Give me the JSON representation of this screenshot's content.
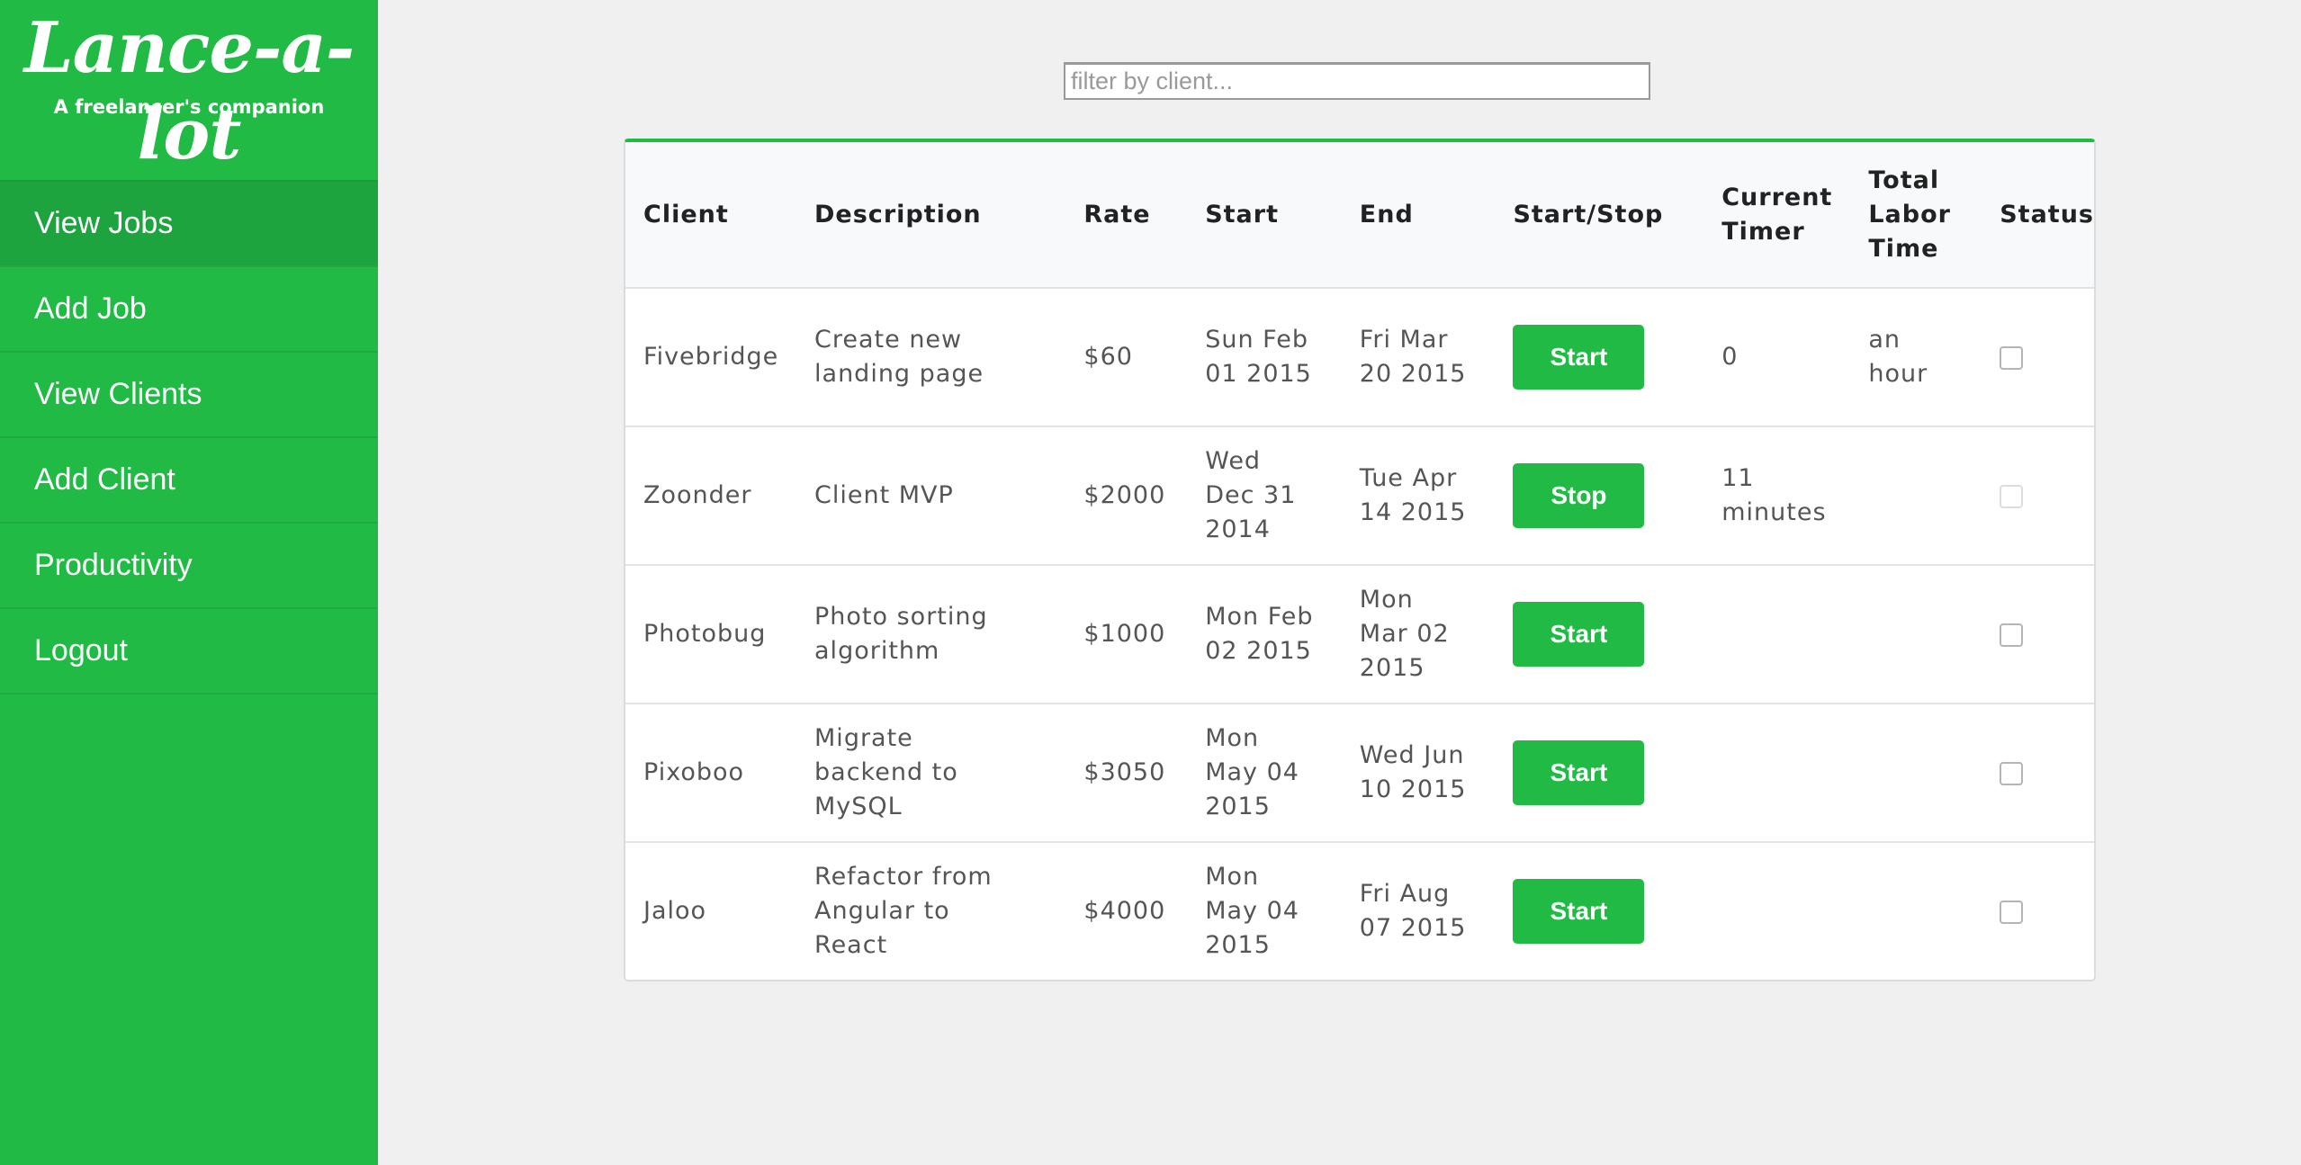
{
  "app": {
    "title": "Lance-a-lot",
    "subtitle": "A freelancer's companion"
  },
  "nav": {
    "items": [
      {
        "label": "View Jobs",
        "active": true
      },
      {
        "label": "Add Job"
      },
      {
        "label": "View Clients"
      },
      {
        "label": "Add Client"
      },
      {
        "label": "Productivity"
      },
      {
        "label": "Logout"
      }
    ]
  },
  "filter": {
    "placeholder": "filter by client...",
    "value": ""
  },
  "table": {
    "headers": [
      "Client",
      "Description",
      "Rate",
      "Start",
      "End",
      "Start/Stop",
      "Current Timer",
      "Total Labor Time",
      "Status"
    ],
    "rows": [
      {
        "client": "Fivebridge",
        "description": "Create new landing page",
        "rate": "$60",
        "start": "Sun Feb 01 2015",
        "end": "Fri Mar 20 2015",
        "action": "Start",
        "timer": "0",
        "labor": "an hour",
        "status": false
      },
      {
        "client": "Zoonder",
        "description": "Client MVP",
        "rate": "$2000",
        "start": "Wed Dec 31 2014",
        "end": "Tue Apr 14 2015",
        "action": "Stop",
        "timer": "11 minutes",
        "labor": "",
        "status": false
      },
      {
        "client": "Photobug",
        "description": "Photo sorting algorithm",
        "rate": "$1000",
        "start": "Mon Feb 02 2015",
        "end": "Mon Mar 02 2015",
        "action": "Start",
        "timer": "",
        "labor": "",
        "status": false
      },
      {
        "client": "Pixoboo",
        "description": "Migrate backend to MySQL",
        "rate": "$3050",
        "start": "Mon May 04 2015",
        "end": "Wed Jun 10 2015",
        "action": "Start",
        "timer": "",
        "labor": "",
        "status": false
      },
      {
        "client": "Jaloo",
        "description": "Refactor from Angular to React",
        "rate": "$4000",
        "start": "Mon May 04 2015",
        "end": "Fri Aug 07 2015",
        "action": "Start",
        "timer": "",
        "labor": "",
        "status": false
      }
    ]
  },
  "colors": {
    "accent": "#21ba45",
    "background": "#f1f0f0"
  }
}
